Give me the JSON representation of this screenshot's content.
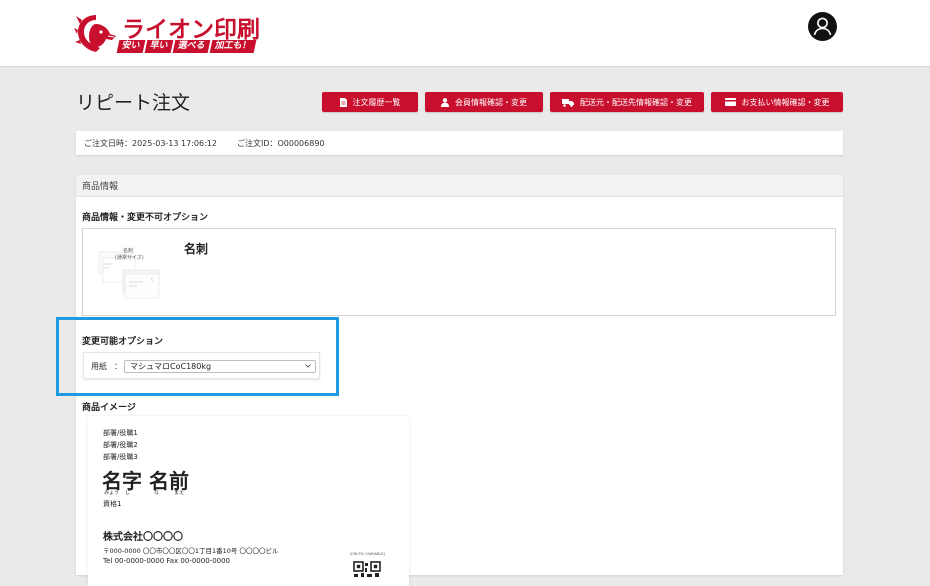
{
  "header": {
    "logo": {
      "name": "ライオン印刷",
      "tagline": [
        "安い",
        "早い",
        "選べる",
        "加工も！"
      ]
    }
  },
  "page": {
    "title": "リピート注文"
  },
  "actions": [
    {
      "label": "注文履歴一覧",
      "icon": "document-icon"
    },
    {
      "label": "会員情報確認・変更",
      "icon": "person-icon"
    },
    {
      "label": "配送元・配送先情報確認・変更",
      "icon": "truck-icon"
    },
    {
      "label": "お支払い情報確認・変更",
      "icon": "card-icon"
    }
  ],
  "order": {
    "date_label": "ご注文日時：2025-03-13 17:06:12",
    "id_label": "ご注文ID：O00006890"
  },
  "product": {
    "panel_title": "商品情報",
    "fixed_title": "商品情報・変更不可オプション",
    "name": "名刺",
    "thumb_caption": [
      "名刺",
      "(通常サイズ)"
    ],
    "changeable_title": "変更可能オプション",
    "paper_label": "用紙",
    "paper_separator": "：",
    "paper_value": "マシュマロCoC180kg",
    "image_title": "商品イメージ"
  },
  "card_preview": {
    "titles": [
      "部署/役職1",
      "部署/役職2",
      "部署/役職3"
    ],
    "name_parts": [
      "名字",
      "名前"
    ],
    "ruby": [
      "みょう",
      "じ",
      "な",
      "まえ"
    ],
    "qualification": "資格1",
    "company": "株式会社〇〇〇〇",
    "address": "〒000-0000 〇〇市〇〇区〇〇1丁目1番10号 〇〇〇〇ビル",
    "tel": "Tel 00-0000-0000    Fax 00-0000-0000",
    "qr_label": "JOIN PIC (VARIABLE)"
  },
  "colors": {
    "brand": "#c8102e",
    "highlight": "#1e9ae0",
    "background": "#ebeaeb"
  }
}
